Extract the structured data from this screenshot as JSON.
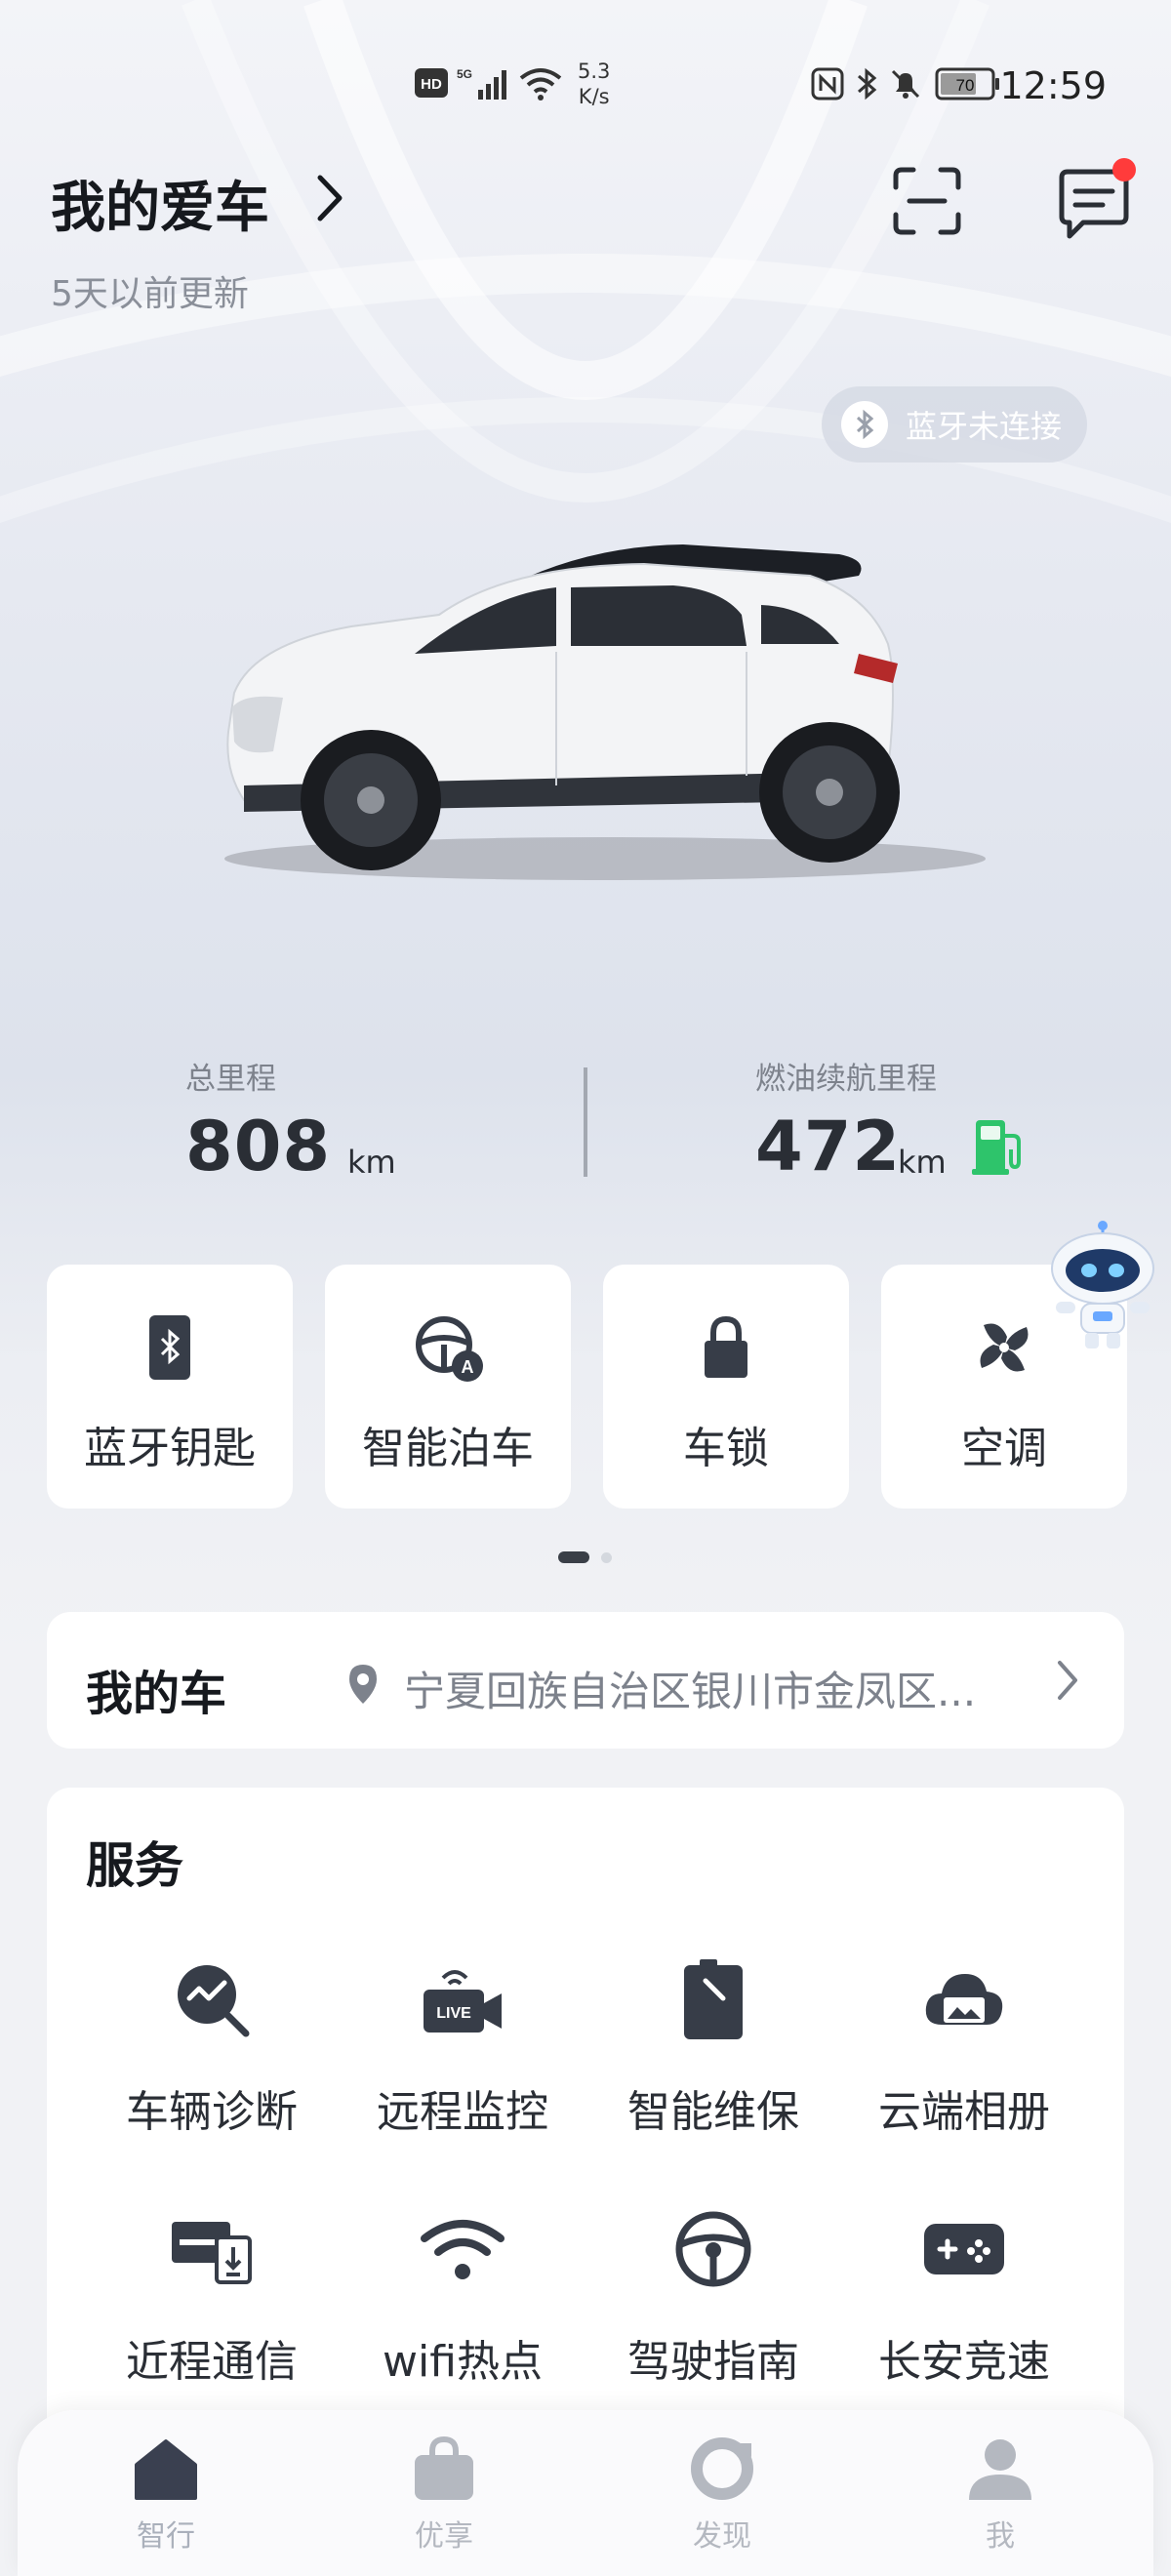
{
  "status_bar": {
    "time": "12:59",
    "net_speed_value": "5.3",
    "net_speed_unit": "K/s",
    "battery": "70",
    "hd": "HD",
    "network": "5G"
  },
  "header": {
    "title": "我的爱车",
    "subtitle": "5天以前更新"
  },
  "bluetooth_status": "蓝牙未连接",
  "stats": {
    "total_mileage_label": "总里程",
    "total_mileage_value": "808",
    "total_mileage_unit": "km",
    "fuel_range_label": "燃油续航里程",
    "fuel_range_value": "472",
    "fuel_range_unit": "km"
  },
  "quick_actions": [
    {
      "label": "蓝牙钥匙",
      "icon": "bluetooth-key-icon"
    },
    {
      "label": "智能泊车",
      "icon": "auto-park-icon"
    },
    {
      "label": "车锁",
      "icon": "lock-icon"
    },
    {
      "label": "空调",
      "icon": "fan-icon"
    }
  ],
  "pager": {
    "pages": 2,
    "active": 1
  },
  "my_car": {
    "title": "我的车",
    "address": "宁夏回族自治区银川市金凤区..."
  },
  "services": {
    "title": "服务",
    "items": [
      {
        "label": "车辆诊断",
        "icon": "diagnosis-icon"
      },
      {
        "label": "远程监控",
        "icon": "live-camera-icon"
      },
      {
        "label": "智能维保",
        "icon": "maintenance-icon"
      },
      {
        "label": "云端相册",
        "icon": "cloud-album-icon"
      },
      {
        "label": "近程通信",
        "icon": "near-field-icon"
      },
      {
        "label": "wifi热点",
        "icon": "wifi-icon"
      },
      {
        "label": "驾驶指南",
        "icon": "steering-wheel-icon"
      },
      {
        "label": "长安竞速",
        "icon": "gamepad-icon"
      }
    ]
  },
  "tabs": [
    {
      "label": "智行",
      "icon": "home-icon",
      "active": true
    },
    {
      "label": "优享",
      "icon": "bag-icon",
      "active": false
    },
    {
      "label": "发现",
      "icon": "discover-icon",
      "active": false
    },
    {
      "label": "我",
      "icon": "profile-icon",
      "active": false
    }
  ],
  "colors": {
    "accent_dark": "#373d48",
    "fuel_green": "#2ec46b",
    "notification_red": "#ff3b3b"
  }
}
